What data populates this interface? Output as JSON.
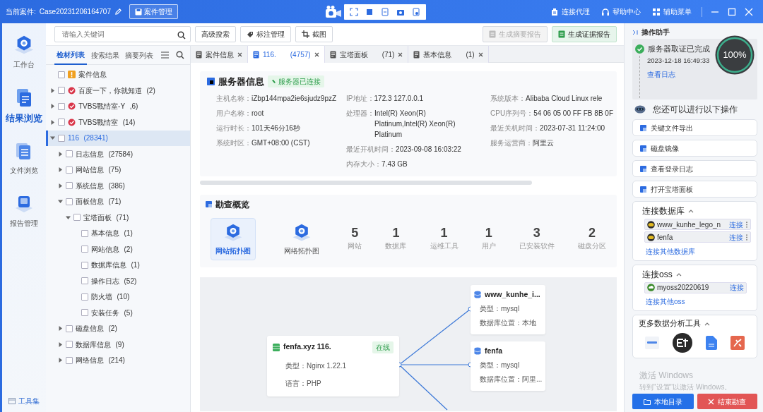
{
  "title_bar": {
    "case_label": "当前案件:",
    "case_id": "Case20231206164707",
    "case_button": "案件管理",
    "menu": [
      {
        "label": "连接代理"
      },
      {
        "label": "帮助中心"
      },
      {
        "label": "辅助菜单"
      }
    ]
  },
  "nav": [
    {
      "label": "工作台",
      "selected": false
    },
    {
      "label": "结果浏览",
      "selected": true
    },
    {
      "label": "文件浏览",
      "selected": false
    },
    {
      "label": "报告管理",
      "selected": false
    }
  ],
  "toolset": "工具集",
  "toolbar": {
    "search": {
      "placeholder": "请输入关键词"
    },
    "buttons": [
      {
        "label": "高级搜索"
      },
      {
        "label": "标注管理"
      },
      {
        "label": "截图"
      }
    ],
    "reports": [
      {
        "label": "生成摘要报告",
        "disabled": true
      },
      {
        "label": "生成证据报告",
        "disabled": false
      }
    ]
  },
  "tree_tabs": [
    {
      "label": "检材列表",
      "selected": true
    },
    {
      "label": "搜索结果",
      "selected": false
    },
    {
      "label": "摘要列表",
      "selected": false
    }
  ],
  "tree": [
    {
      "kind": "case",
      "label": "案件信息",
      "checked": false,
      "selected": false
    },
    {
      "kind": "site",
      "label": "百度一下，你就知道",
      "count": "(2)",
      "checked": false,
      "selected": false,
      "expanded": false
    },
    {
      "kind": "site",
      "label": "TVBS戰情室-Y",
      "count": ",6)",
      "checked": false,
      "selected": false,
      "expanded": false
    },
    {
      "kind": "site",
      "label": "TVBS戰情室",
      "count": "(14)",
      "checked": false,
      "selected": false,
      "expanded": false
    },
    {
      "label": "116",
      "count": "(28341)",
      "checked": false,
      "selected": true,
      "expanded": true,
      "children": [
        {
          "label": "日志信息",
          "count": "(27584)",
          "checked": false,
          "selected": false,
          "expanded": false
        },
        {
          "label": "网站信息",
          "count": "(75)",
          "checked": false,
          "selected": false,
          "expanded": false
        },
        {
          "label": "系统信息",
          "count": "(386)",
          "checked": false,
          "selected": false,
          "expanded": false
        },
        {
          "label": "面板信息",
          "count": "(71)",
          "checked": false,
          "selected": false,
          "expanded": true,
          "children": [
            {
              "label": "宝塔面板",
              "count": "(71)",
              "checked": false,
              "selected": false,
              "expanded": true,
              "children": [
                {
                  "label": "基本信息",
                  "count": "(1)",
                  "checked": false,
                  "selected": false
                },
                {
                  "label": "网站信息",
                  "count": "(2)",
                  "checked": false,
                  "selected": false
                },
                {
                  "label": "数据库信息",
                  "count": "(1)",
                  "checked": false,
                  "selected": false
                },
                {
                  "label": "操作日志",
                  "count": "(52)",
                  "checked": false,
                  "selected": false
                },
                {
                  "label": "防火墙",
                  "count": "(10)",
                  "checked": false,
                  "selected": false
                },
                {
                  "label": "安装任务",
                  "count": "(5)",
                  "checked": false,
                  "selected": false
                }
              ]
            }
          ]
        },
        {
          "label": "磁盘信息",
          "count": "(2)",
          "checked": false,
          "selected": false,
          "expanded": false
        },
        {
          "label": "数据库信息",
          "count": "(9)",
          "checked": false,
          "selected": false,
          "expanded": false
        },
        {
          "label": "网络信息",
          "count": "(214)",
          "checked": false,
          "selected": false,
          "expanded": false
        }
      ]
    }
  ],
  "doc_tabs": [
    {
      "label": "案件信息",
      "selected": false
    },
    {
      "label": "116.",
      "count": "(4757)",
      "selected": true
    },
    {
      "label": "宝塔面板",
      "count": "(71)",
      "selected": false
    },
    {
      "label": "基本信息",
      "count": "(1)",
      "selected": false
    }
  ],
  "server_info": {
    "title": "服务器信息",
    "badge": "服务器已连接",
    "columns": [
      [
        {
          "label": "主机名称：",
          "value": "iZbp144mpa2ie6sjudz9pzZ"
        },
        {
          "label": "用户名称：",
          "value": "root"
        },
        {
          "label": "运行时长：",
          "value": "101天46分16秒"
        },
        {
          "label": "系统时区：",
          "value": "GMT+08:00 (CST)"
        }
      ],
      [
        {
          "label": "IP地址：",
          "value": "172.3 127.0.0.1"
        },
        {
          "label": "处理器：",
          "value": "Intel(R) Xeon(R) Platinum,Intel(R) Xeon(R) Platinum"
        },
        {
          "label": "最近开机时间：",
          "value": "2023-09-08 16:03:22"
        },
        {
          "label": "内存大小：",
          "value": "7.43 GB"
        }
      ],
      [
        {
          "label": "系统版本：",
          "value": "Alibaba Cloud Linux rele"
        },
        {
          "label": "CPU序列号：",
          "value": "54 06 05 00 FF FB 8B 0F"
        },
        {
          "label": "最近关机时间：",
          "value": "2023-07-31 11:24:00"
        },
        {
          "label": "服务运营商：",
          "value": "阿里云"
        }
      ]
    ]
  },
  "overview": {
    "title": "勘查概览",
    "views": [
      {
        "label": "网站拓扑图",
        "selected": true
      },
      {
        "label": "网络拓扑图",
        "selected": false
      }
    ],
    "stats": [
      {
        "value": "5",
        "label": "网站"
      },
      {
        "value": "1",
        "label": "数据库"
      },
      {
        "value": "1",
        "label": "运维工具"
      },
      {
        "value": "1",
        "label": "用户"
      },
      {
        "value": "3",
        "label": "已安装软件"
      },
      {
        "value": "2",
        "label": "磁盘分区"
      }
    ]
  },
  "topology": {
    "server": {
      "title": "fenfa.xyz 116.",
      "status": "在线",
      "lines": [
        "类型：Nginx 1.22.1",
        "语言：PHP"
      ]
    },
    "databases": [
      {
        "name": "www_kunhe_i...",
        "lines": [
          "类型：mysql",
          "数据库位置：本地"
        ]
      },
      {
        "name": "fenfa",
        "lines": [
          "类型：mysql",
          "数据库位置：阿里..."
        ]
      }
    ]
  },
  "assistant": {
    "title": "操作助手",
    "status": {
      "title": "服务器取证已完成",
      "time": "2023-12-18 16:49:33",
      "link": "查看日志",
      "progress": "100%",
      "level": 1
    },
    "prompt": "您还可以进行以下操作",
    "actions": [
      {
        "label": "关键文件导出"
      },
      {
        "label": "磁盘镜像"
      },
      {
        "label": "查看登录日志"
      },
      {
        "label": "打开宝塔面板"
      }
    ],
    "database": {
      "title": "连接数据库",
      "expanded": true,
      "items": [
        {
          "name": "www_kunhe_lego_n",
          "action": "连接"
        },
        {
          "name": "fenfa",
          "action": "连接"
        }
      ],
      "more": "连接其他数据库"
    },
    "oss": {
      "title": "连接oss",
      "expanded": true,
      "items": [
        {
          "name": "myoss20220619",
          "action": "连接"
        }
      ],
      "more": "连接其他oss"
    },
    "tools": {
      "title": "更多数据分析工具",
      "expanded": true
    },
    "os_notice": {
      "title": "激活 Windows",
      "text": "转到\"设置\"以激活 Windows。"
    },
    "buttons": [
      {
        "label": "本地目录",
        "kind": "primary"
      },
      {
        "label": "结束勘查",
        "kind": "danger"
      }
    ]
  }
}
